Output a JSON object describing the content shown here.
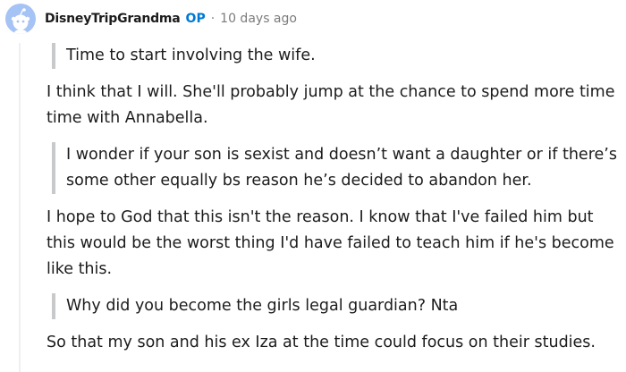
{
  "comment": {
    "username": "DisneyTripGrandma",
    "op_badge": "OP",
    "separator": "·",
    "timestamp": "10 days ago",
    "blocks": [
      {
        "type": "quote",
        "text": "Time to start involving the wife."
      },
      {
        "type": "para",
        "text": "I think that I will. She'll probably jump at the chance to spend more time time with Annabella."
      },
      {
        "type": "quote",
        "text": "I wonder if your son is sexist and doesn’t want a daughter or if there’s some other equally bs reason he’s decided to abandon her."
      },
      {
        "type": "para",
        "text": "I hope to God that this isn't the reason. I know that I've failed him but this would be the worst thing I'd have failed to teach him if he's become like this."
      },
      {
        "type": "quote",
        "text": "Why did you become the girls legal guardian? Nta"
      },
      {
        "type": "para",
        "text": "So that my son and his ex Iza at the time could focus on their studies."
      }
    ]
  },
  "colors": {
    "avatar_bg": "#a5c3f4",
    "op_badge": "#0079d3",
    "muted_text": "#7c7c7c",
    "quote_bar": "#c8c9cb",
    "thread_line": "#edeff1"
  },
  "icons": {
    "avatar": "reddit-snoo-avatar-icon"
  }
}
